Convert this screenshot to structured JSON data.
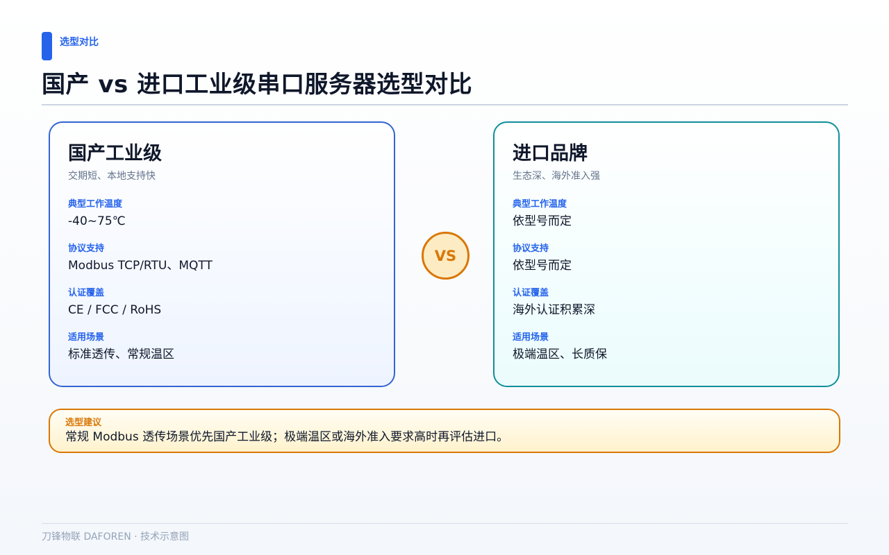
{
  "header": {
    "tag": "选型对比",
    "title": "国产 vs 进口工业级串口服务器选型对比"
  },
  "cards": {
    "domestic": {
      "title": "国产工业级",
      "subtitle": "交期短、本地支持快",
      "specs": [
        {
          "label": "典型工作温度",
          "value": "-40~75℃"
        },
        {
          "label": "协议支持",
          "value": "Modbus TCP/RTU、MQTT"
        },
        {
          "label": "认证覆盖",
          "value": "CE / FCC / RoHS"
        },
        {
          "label": "适用场景",
          "value": "标准透传、常规温区"
        }
      ]
    },
    "imported": {
      "title": "进口品牌",
      "subtitle": "生态深、海外准入强",
      "specs": [
        {
          "label": "典型工作温度",
          "value": "依型号而定"
        },
        {
          "label": "协议支持",
          "value": "依型号而定"
        },
        {
          "label": "认证覆盖",
          "value": "海外认证积累深"
        },
        {
          "label": "适用场景",
          "value": "极端温区、长质保"
        }
      ]
    }
  },
  "vs_label": "VS",
  "recommendation": {
    "label": "选型建议",
    "text": "常规 Modbus 透传场景优先国产工业级；极端温区或海外准入要求高时再评估进口。"
  },
  "footer": {
    "text": "刀锋物联 DAFOREN · 技术示意图"
  },
  "colors": {
    "primary": "#2563eb",
    "teal": "#0f8f9a",
    "amber": "#d97706",
    "title": "#0f172a",
    "muted": "#64748b"
  }
}
